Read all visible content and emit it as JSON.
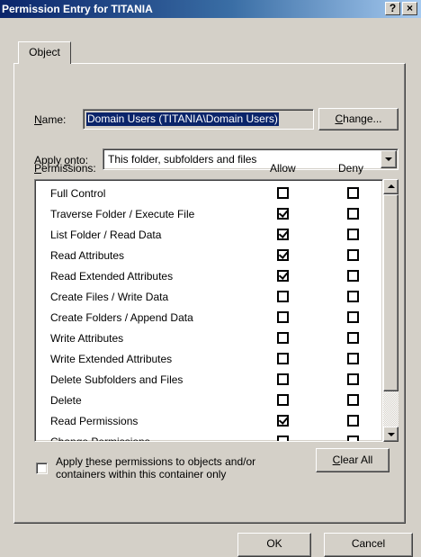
{
  "window": {
    "title": "Permission Entry for TITANIA",
    "help_icon": "?",
    "close_icon": "×"
  },
  "tabs": [
    {
      "label": "Object"
    }
  ],
  "name": {
    "label": "Name:",
    "value": "Domain Users (TITANIA\\Domain Users)",
    "change_button": "Change..."
  },
  "apply_onto": {
    "label": "Apply onto:",
    "value": "This folder, subfolders and files"
  },
  "permissions": {
    "label": "Permissions:",
    "allow_header": "Allow",
    "deny_header": "Deny",
    "items": [
      {
        "name": "Full Control",
        "allow": false,
        "deny": false
      },
      {
        "name": "Traverse Folder / Execute File",
        "allow": true,
        "deny": false
      },
      {
        "name": "List Folder / Read Data",
        "allow": true,
        "deny": false
      },
      {
        "name": "Read Attributes",
        "allow": true,
        "deny": false
      },
      {
        "name": "Read Extended Attributes",
        "allow": true,
        "deny": false
      },
      {
        "name": "Create Files / Write Data",
        "allow": false,
        "deny": false
      },
      {
        "name": "Create Folders / Append Data",
        "allow": false,
        "deny": false
      },
      {
        "name": "Write Attributes",
        "allow": false,
        "deny": false
      },
      {
        "name": "Write Extended Attributes",
        "allow": false,
        "deny": false
      },
      {
        "name": "Delete Subfolders and Files",
        "allow": false,
        "deny": false
      },
      {
        "name": "Delete",
        "allow": false,
        "deny": false
      },
      {
        "name": "Read Permissions",
        "allow": true,
        "deny": false
      },
      {
        "name": "Change Permissions",
        "allow": false,
        "deny": false
      }
    ]
  },
  "apply_to_container": {
    "line1": "Apply these permissions to objects and/or",
    "line2": "containers within this container only",
    "checked": false
  },
  "buttons": {
    "clear_all": "Clear All",
    "ok": "OK",
    "cancel": "Cancel"
  }
}
